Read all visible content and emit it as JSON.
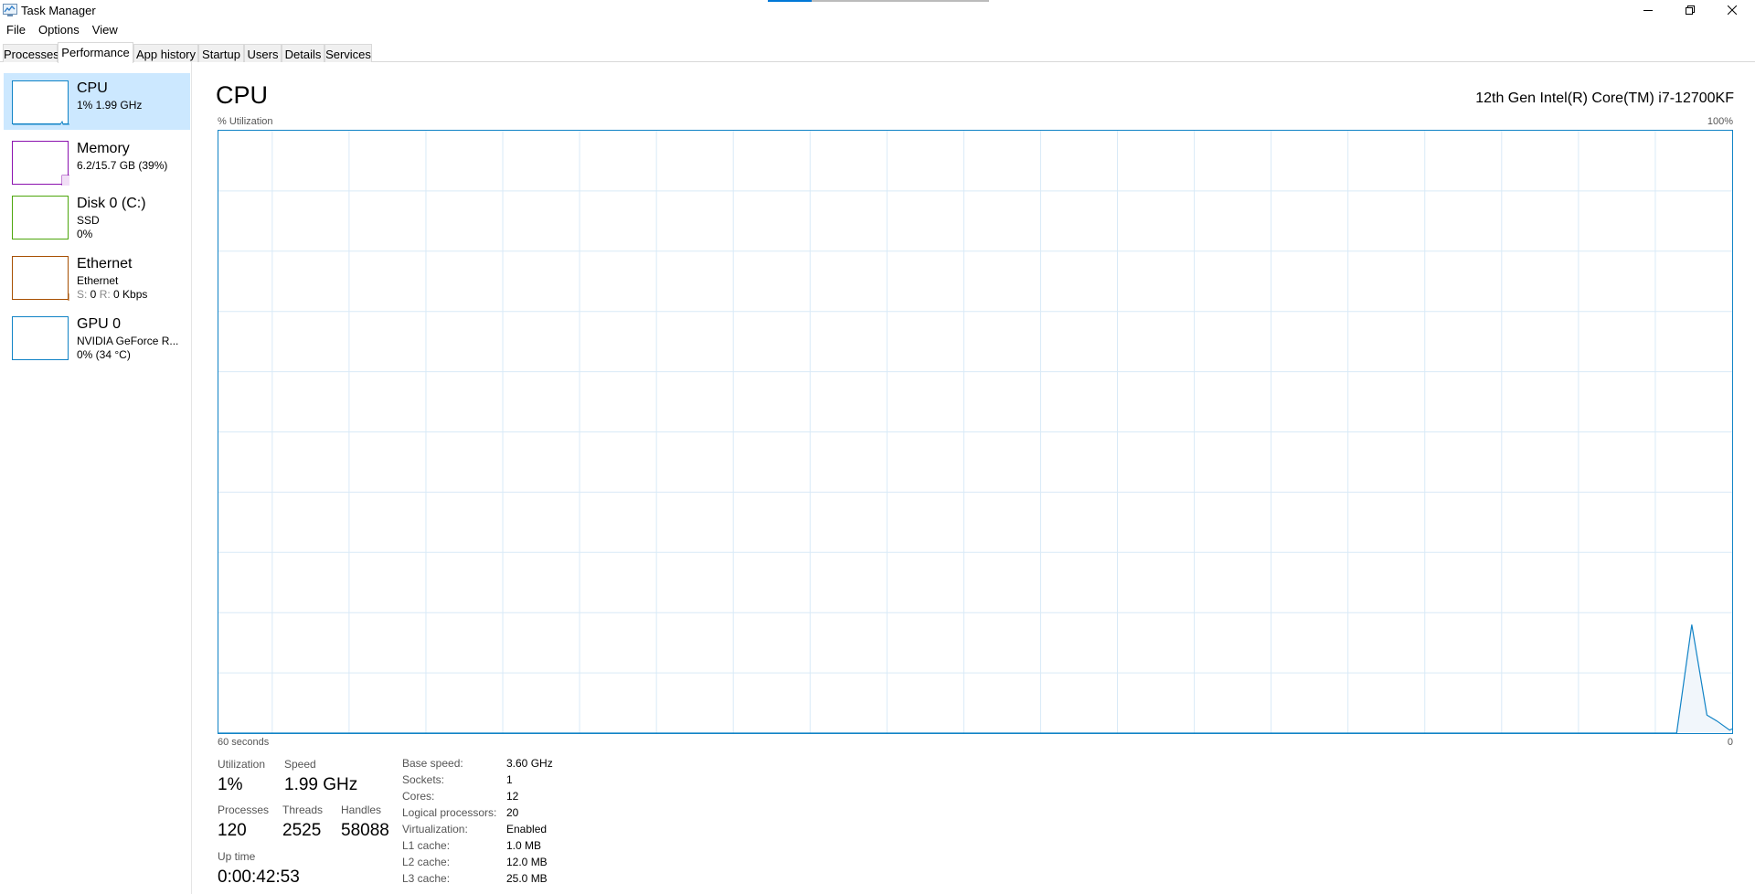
{
  "window": {
    "title": "Task Manager"
  },
  "menu": [
    "File",
    "Options",
    "View"
  ],
  "tabs": [
    "Processes",
    "Performance",
    "App history",
    "Startup",
    "Users",
    "Details",
    "Services"
  ],
  "active_tab": "Performance",
  "sidebar": {
    "items": [
      {
        "name": "CPU",
        "line1": "1%  1.99 GHz",
        "line2": "",
        "color": "#1183c6",
        "selected": true
      },
      {
        "name": "Memory",
        "line1": "6.2/15.7 GB (39%)",
        "line2": "",
        "color": "#8b12ae",
        "selected": false
      },
      {
        "name": "Disk 0 (C:)",
        "line1": "SSD",
        "line2": "0%",
        "color": "#4da60c",
        "selected": false
      },
      {
        "name": "Ethernet",
        "line1": "Ethernet",
        "line2_prefix_s": "S:",
        "line2_s": " 0 ",
        "line2_prefix_r": "R:",
        "line2_r": " 0 Kbps",
        "color": "#a74f01",
        "selected": false
      },
      {
        "name": "GPU 0",
        "line1": "NVIDIA GeForce R...",
        "line2": "0% (34 °C)",
        "color": "#1183c6",
        "selected": false
      }
    ]
  },
  "main": {
    "title": "CPU",
    "model": "12th Gen Intel(R) Core(TM) i7-12700KF",
    "y_label": "% Utilization",
    "y_max_label": "100%",
    "x_label": "60 seconds",
    "y_min_label": "0"
  },
  "chart_data": {
    "type": "area",
    "title": "CPU",
    "xlabel": "60 seconds",
    "ylabel": "% Utilization",
    "ylim": [
      0,
      100
    ],
    "xlim": [
      60,
      0
    ],
    "grid": true,
    "color": "#1183c6",
    "series": [
      {
        "x": [
          60,
          2.2,
          1.6,
          1.0,
          0.6,
          0.1,
          0
        ],
        "values": [
          0,
          0,
          18,
          3,
          2,
          0.5,
          0.7
        ]
      }
    ]
  },
  "stats": {
    "utilization_label": "Utilization",
    "utilization": "1%",
    "speed_label": "Speed",
    "speed": "1.99 GHz",
    "processes_label": "Processes",
    "processes": "120",
    "threads_label": "Threads",
    "threads": "2525",
    "handles_label": "Handles",
    "handles": "58088",
    "uptime_label": "Up time",
    "uptime": "0:00:42:53"
  },
  "details": [
    {
      "label": "Base speed:",
      "value": "3.60 GHz"
    },
    {
      "label": "Sockets:",
      "value": "1"
    },
    {
      "label": "Cores:",
      "value": "12"
    },
    {
      "label": "Logical processors:",
      "value": "20"
    },
    {
      "label": "Virtualization:",
      "value": "Enabled"
    },
    {
      "label": "L1 cache:",
      "value": "1.0 MB"
    },
    {
      "label": "L2 cache:",
      "value": "12.0 MB"
    },
    {
      "label": "L3 cache:",
      "value": "25.0 MB"
    }
  ]
}
